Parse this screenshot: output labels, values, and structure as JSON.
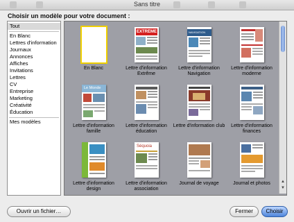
{
  "window": {
    "title": "Sans titre"
  },
  "prompt": "Choisir un modèle pour votre document :",
  "sidebar": {
    "items": [
      "Tout",
      "En Blanc",
      "Lettres d'information",
      "Journaux",
      "Annonces",
      "Affiches",
      "Invitations",
      "Lettres",
      "CV",
      "Entreprise",
      "Marketing",
      "Créativité",
      "Éducation",
      "Mes modèles"
    ],
    "selected": "Tout"
  },
  "templates": [
    {
      "label": "En Blanc"
    },
    {
      "label": "Lettre d'information\nExtrême"
    },
    {
      "label": "Lettre d'information\nNavigation"
    },
    {
      "label": "Lettre d'information\nmoderne"
    },
    {
      "label": "Lettre d'information\nfamille"
    },
    {
      "label": "Lettre d'information\néducation"
    },
    {
      "label": "Lettre d'information club"
    },
    {
      "label": "Lettre d'information\nfinances"
    },
    {
      "label": "Lettre d'information\ndesign"
    },
    {
      "label": "Lettre d'information\nassociation"
    },
    {
      "label": "Journal de voyage"
    },
    {
      "label": "Journal et photos"
    }
  ],
  "thumbnail_text": {
    "extreme": "EXTRÊME",
    "navigation": "NAVIGATION",
    "famille": "Le Monde",
    "sequoia": "Séquoia"
  },
  "buttons": {
    "open_file": "Ouvrir un fichier…",
    "close": "Fermer",
    "choose": "Choisir"
  },
  "colors": {
    "gallery_bg": "#9e9fa6",
    "selection": "#f0d000",
    "default_button": "#4f86db"
  }
}
